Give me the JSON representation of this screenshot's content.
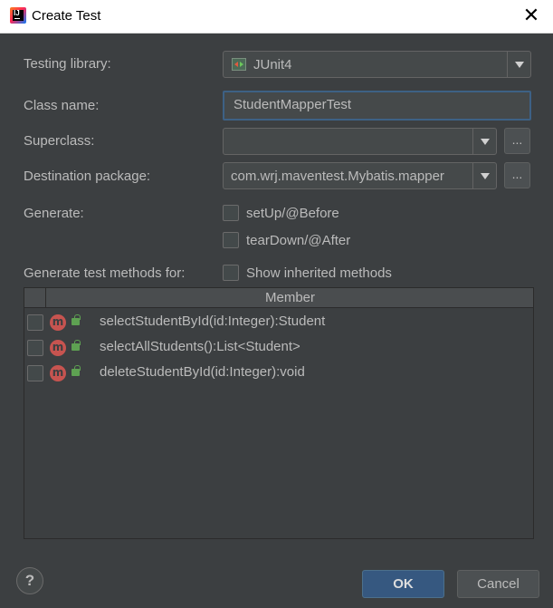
{
  "window": {
    "title": "Create Test"
  },
  "form": {
    "testing_library_label": "Testing library:",
    "testing_library_value": "JUnit4",
    "class_name_label": "Class name:",
    "class_name_value": "StudentMapperTest",
    "superclass_label": "Superclass:",
    "superclass_value": "",
    "destination_package_label": "Destination package:",
    "destination_package_value": "com.wrj.maventest.Mybatis.mapper",
    "browse_label": "...",
    "generate_label": "Generate:",
    "setup_label": "setUp/@Before",
    "teardown_label": "tearDown/@After",
    "generate_methods_label": "Generate test methods for:",
    "show_inherited_label": "Show inherited methods"
  },
  "table": {
    "header": "Member",
    "rows": [
      {
        "label": "selectStudentById(id:Integer):Student",
        "icon": "method-icon"
      },
      {
        "label": "selectAllStudents():List<Student>",
        "icon": "method-icon"
      },
      {
        "label": "deleteStudentById(id:Integer):void",
        "icon": "method-icon"
      }
    ]
  },
  "footer": {
    "help_label": "?",
    "ok_label": "OK",
    "cancel_label": "Cancel"
  },
  "colors": {
    "background": "#3c3f41",
    "accent": "#365880",
    "method_icon": "#c75450"
  }
}
